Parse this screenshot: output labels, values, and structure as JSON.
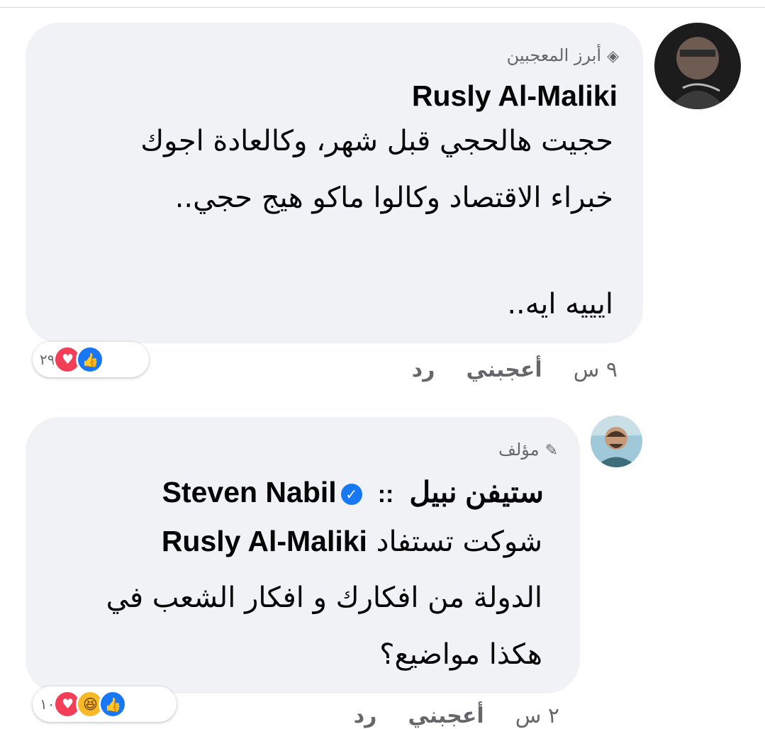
{
  "comments": [
    {
      "badge_icon": "diamond-icon",
      "badge": "أبرز المعجبين",
      "author": "Rusly Al-Maliki",
      "lines": [
        "حجيت هالحجي قبل شهر، وكالعادة اجوك",
        "خبراء الاقتصاد وكالوا ماكو هيج حجي..",
        "ايييه ايه.."
      ],
      "reactions": {
        "icons": [
          "like-icon",
          "heart-icon"
        ],
        "count": "٢٩"
      },
      "actions": {
        "time": "٩ س",
        "like": "أعجبني",
        "reply": "رد"
      }
    },
    {
      "badge_icon": "pencil-icon",
      "badge": "مؤلف",
      "author": "ستيفن نبيل",
      "separator": "::",
      "mention": "Steven Nabil",
      "reply_prefix": "شوكت تستفاد",
      "reply_mention": "Rusly Al-Maliki",
      "lines": [
        "الدولة من افكارك و افكار الشعب في",
        "هكذا مواضيع؟"
      ],
      "reactions": {
        "icons": [
          "like-icon",
          "haha-icon",
          "heart-icon"
        ],
        "count": "١٠"
      },
      "actions": {
        "time": "٢ س",
        "like": "أعجبني",
        "reply": "رد"
      }
    }
  ],
  "colors": {
    "bubble": "#f0f2f5",
    "secondary_text": "#65676b",
    "like_blue": "#1877f2",
    "heart_red": "#f33e58",
    "haha_yellow": "#f7b928"
  }
}
